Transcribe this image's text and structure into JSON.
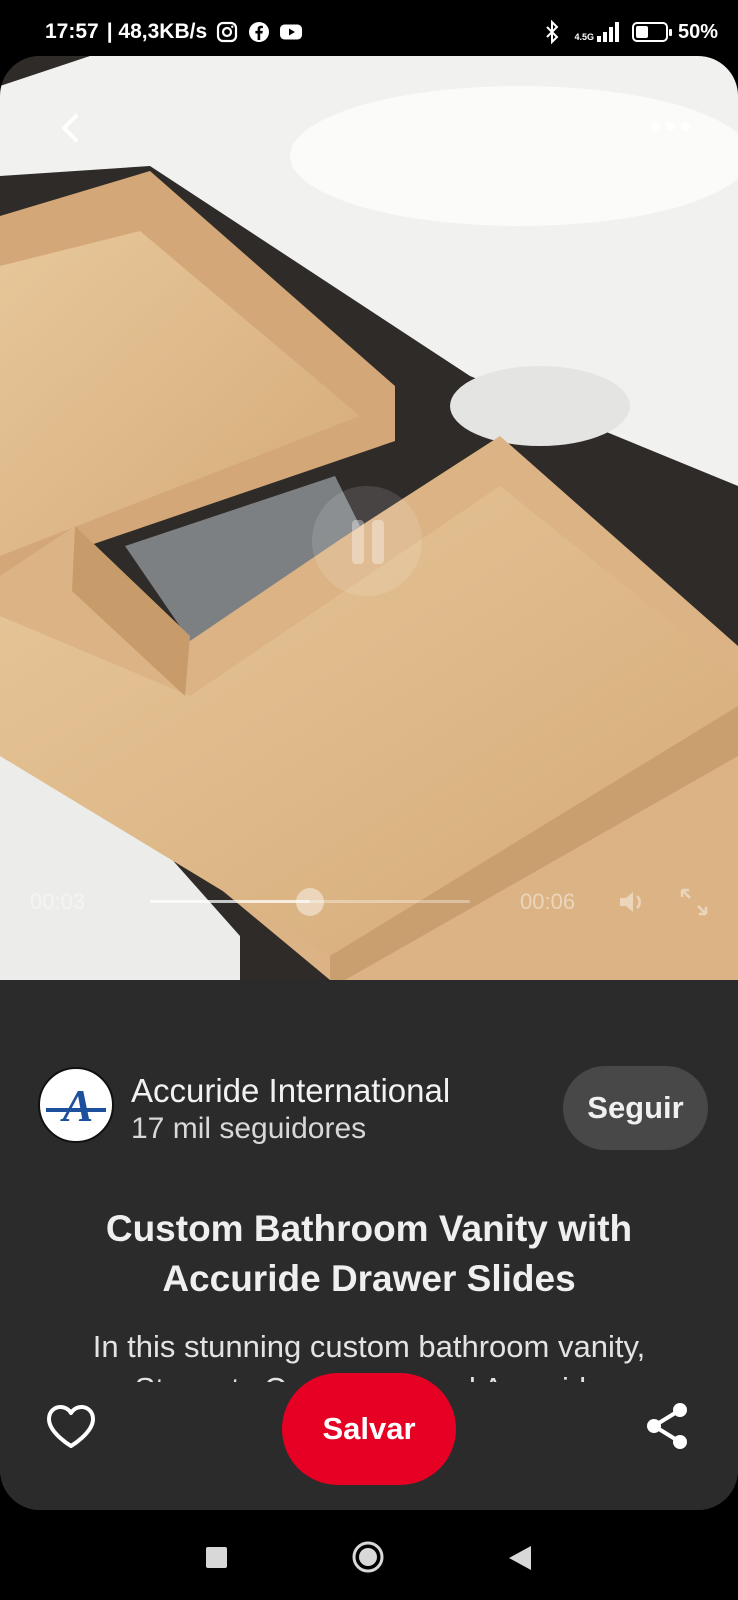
{
  "status_bar": {
    "time": "17:57",
    "speed": "| 48,3KB/s",
    "network": "4.5G",
    "battery": "50%",
    "battery_level": 0.5,
    "icons": [
      "instagram-icon",
      "facebook-icon",
      "youtube-icon",
      "bluetooth-icon",
      "signal-icon",
      "battery-icon"
    ]
  },
  "video": {
    "current_time": "00:03",
    "total_time": "00:06",
    "progress": 0.5,
    "state": "paused"
  },
  "creator": {
    "name": "Accuride International",
    "followers": "17 mil seguidores",
    "follow_label": "Seguir",
    "logo_letter": "A",
    "brand_color": "#1c4f9c"
  },
  "pin": {
    "title": "Custom Bathroom Vanity with Accuride Drawer Slides",
    "description": "In this stunning custom bathroom vanity, Stewarts Carpentry used Accuride"
  },
  "actions": {
    "save_label": "Salvar",
    "save_color": "#e60023"
  },
  "icons": {
    "back": "chevron-left-icon",
    "more": "more-icon",
    "like": "heart-icon",
    "share": "share-icon"
  }
}
